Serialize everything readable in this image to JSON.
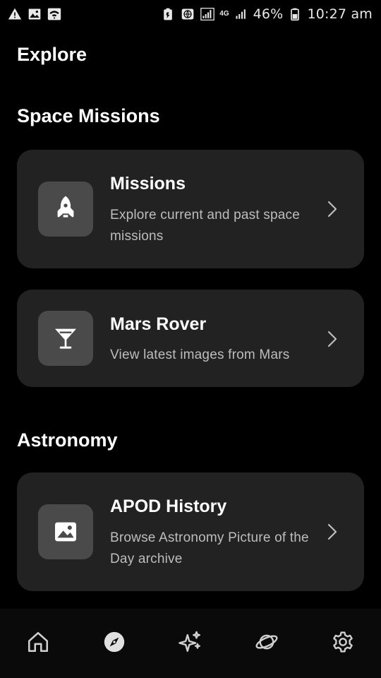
{
  "status_bar": {
    "network_label": "4G",
    "battery_percent": "46%",
    "time": "10:27 am",
    "left_icons": [
      "warning-icon",
      "image-icon",
      "wifi-icon"
    ],
    "right_icons": [
      "battery-saver-icon",
      "vpn-icon",
      "signal-icon",
      "signal-icon",
      "battery-icon"
    ]
  },
  "page": {
    "title": "Explore"
  },
  "sections": [
    {
      "title": "Space Missions",
      "cards": [
        {
          "title": "Missions",
          "description": "Explore current and past space missions",
          "icon": "rocket-icon"
        },
        {
          "title": "Mars Rover",
          "description": "View latest images from Mars",
          "icon": "martini-glass-icon"
        }
      ]
    },
    {
      "title": "Astronomy",
      "cards": [
        {
          "title": "APOD History",
          "description": "Browse Astronomy Picture of the Day archive",
          "icon": "image-icon"
        }
      ]
    }
  ],
  "bottom_nav": {
    "items": [
      {
        "icon": "home-icon",
        "active": false
      },
      {
        "icon": "compass-icon",
        "active": true
      },
      {
        "icon": "sparkles-icon",
        "active": false
      },
      {
        "icon": "planet-icon",
        "active": false
      },
      {
        "icon": "settings-icon",
        "active": false
      }
    ]
  },
  "colors": {
    "background": "#000000",
    "card": "#222222",
    "icon_box": "#4a4a4a",
    "secondary_text": "#bdbdbd"
  }
}
